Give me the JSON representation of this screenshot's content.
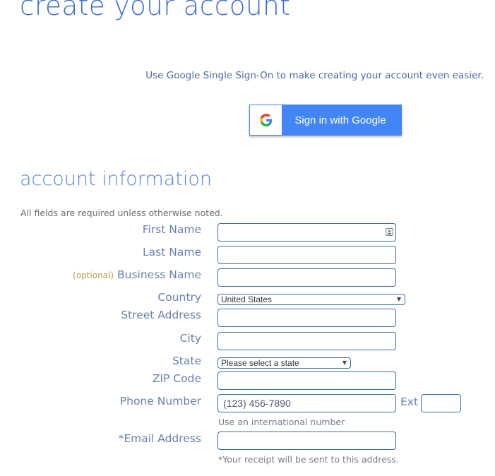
{
  "page": {
    "title": "create your account"
  },
  "sso": {
    "prompt": "Use Google Single Sign-On to make creating your account even easier.",
    "button_label": "Sign in with Google",
    "logo_icon": "google-g-icon",
    "button_color": "#4285f4"
  },
  "account_info": {
    "section_title": "account information",
    "required_note": "All fields are required unless otherwise noted.",
    "fields": {
      "first_name": {
        "label": "First Name",
        "value": ""
      },
      "last_name": {
        "label": "Last Name",
        "value": ""
      },
      "business_name": {
        "optional_tag": "(optional)",
        "label": "Business Name",
        "value": ""
      },
      "country": {
        "label": "Country",
        "selected": "United States"
      },
      "street_address": {
        "label": "Street Address",
        "value": ""
      },
      "city": {
        "label": "City",
        "value": ""
      },
      "state": {
        "label": "State",
        "selected": "Please select a state"
      },
      "zip": {
        "label": "ZIP Code",
        "value": ""
      },
      "phone": {
        "label": "Phone Number",
        "value": "(123) 456-7890",
        "ext_label": "Ext",
        "ext_value": "",
        "hint": "Use an international number"
      },
      "email": {
        "label": "*Email Address",
        "value": "",
        "hint": "*Your receipt will be sent to this address."
      }
    }
  },
  "colors": {
    "title": "#3b6fce",
    "input_border": "#3a6ea5",
    "optional_tag": "#b59d4a"
  }
}
